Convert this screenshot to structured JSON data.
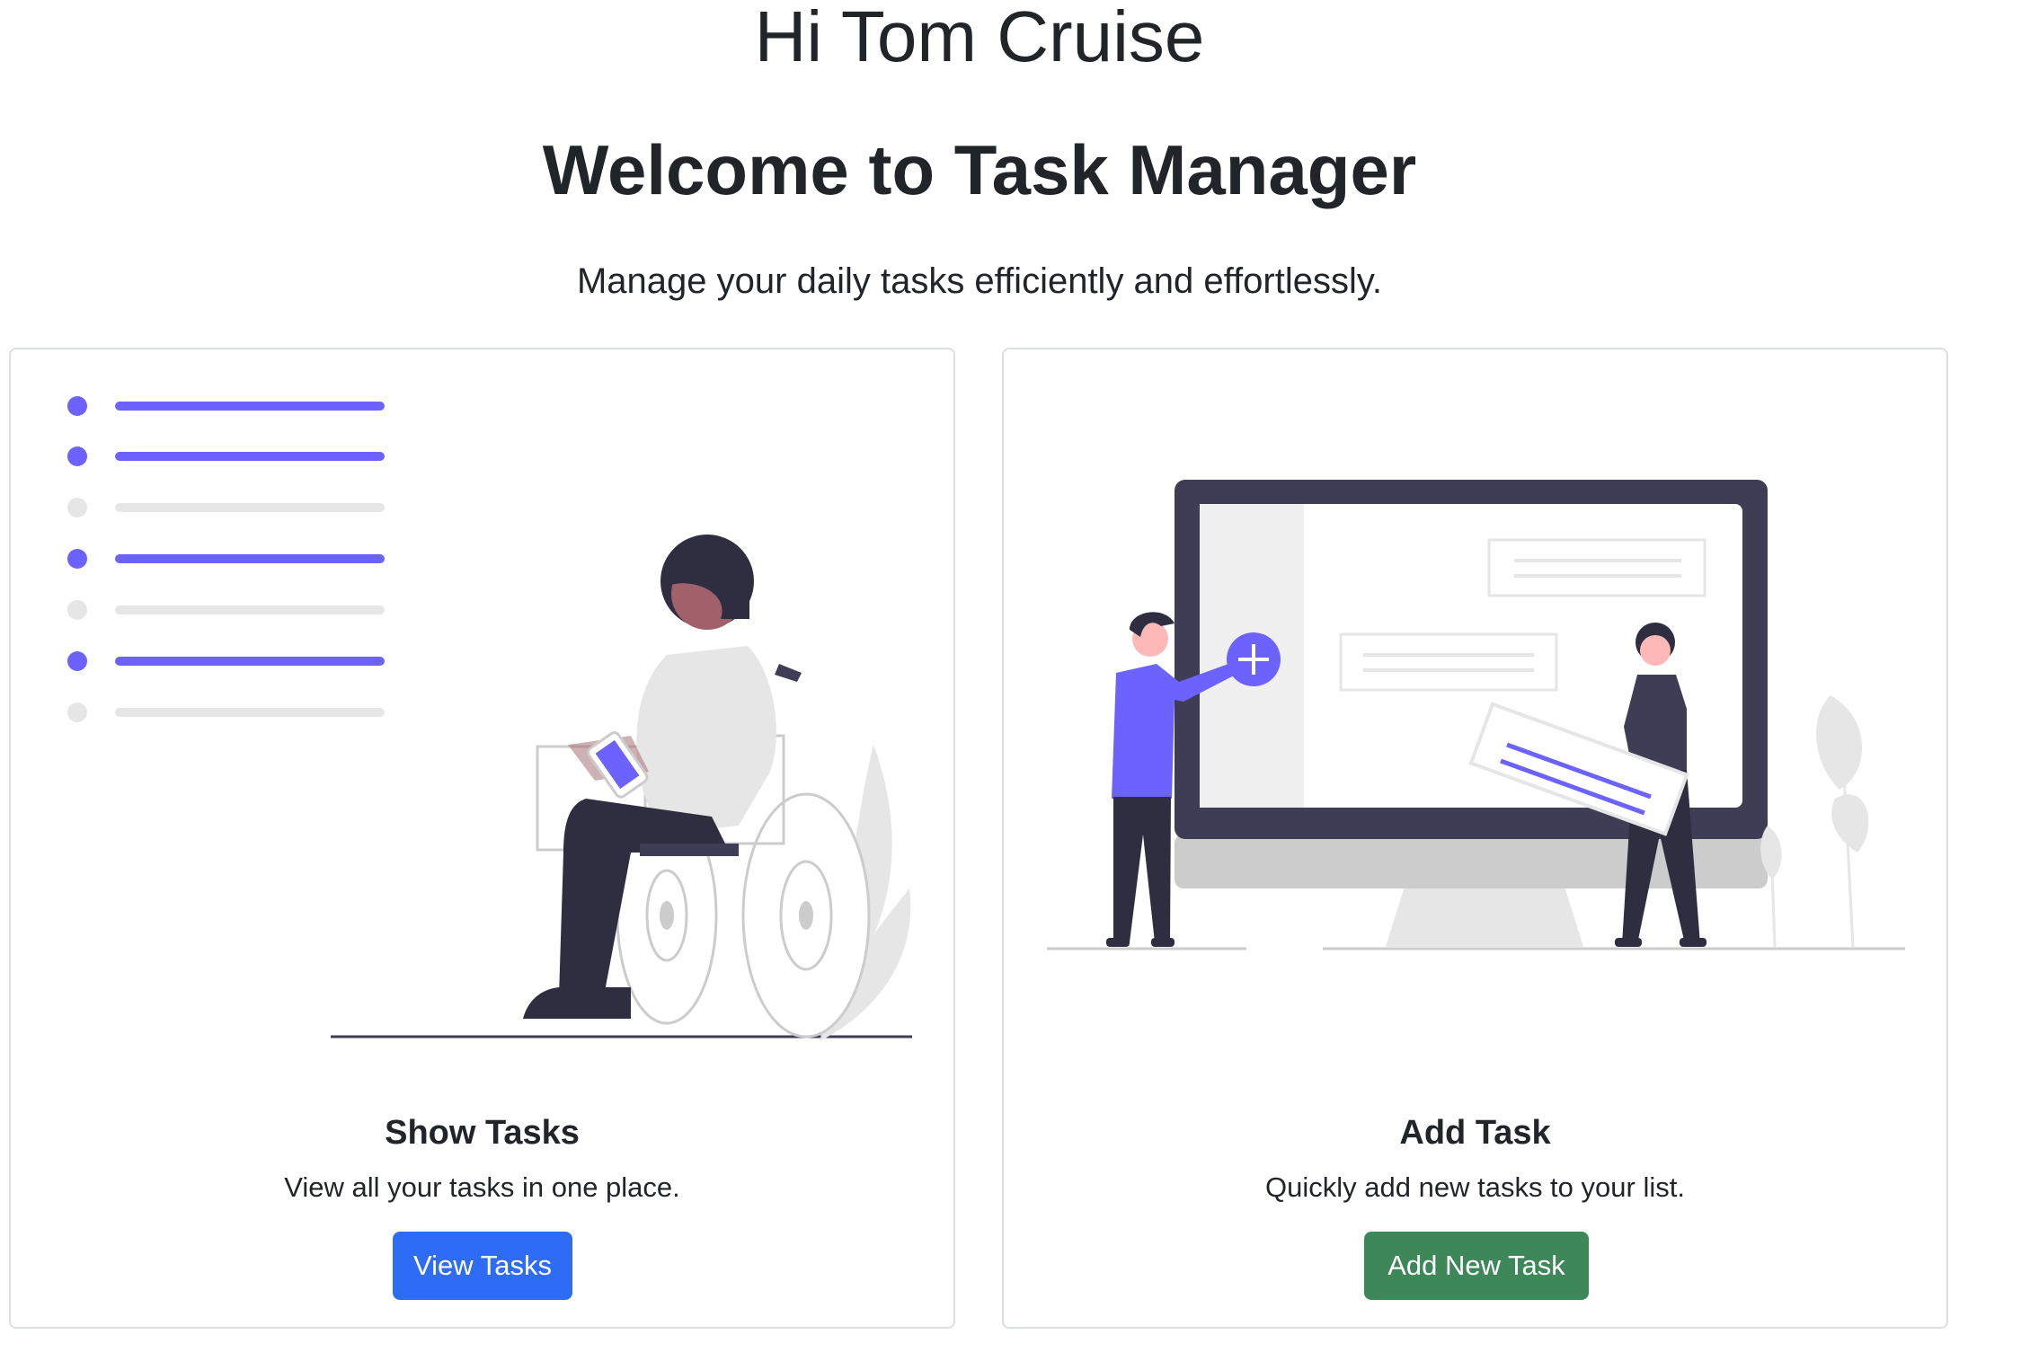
{
  "header": {
    "greeting": "Hi Tom Cruise",
    "title": "Welcome to Task Manager",
    "subtitle": "Manage your daily tasks efficiently and effortlessly."
  },
  "cards": [
    {
      "title": "Show Tasks",
      "text": "View all your tasks in one place.",
      "button_label": "View Tasks",
      "button_color": "#2f6cf5",
      "illustration": "person-in-wheelchair-with-task-list-illustration"
    },
    {
      "title": "Add Task",
      "text": "Quickly add new tasks to your list.",
      "button_label": "Add New Task",
      "button_color": "#3d8758",
      "illustration": "people-adding-tasks-on-monitor-illustration"
    }
  ],
  "colors": {
    "accent": "#6c63ff",
    "dark": "#3f3d56",
    "light_gray": "#e6e6e6"
  }
}
